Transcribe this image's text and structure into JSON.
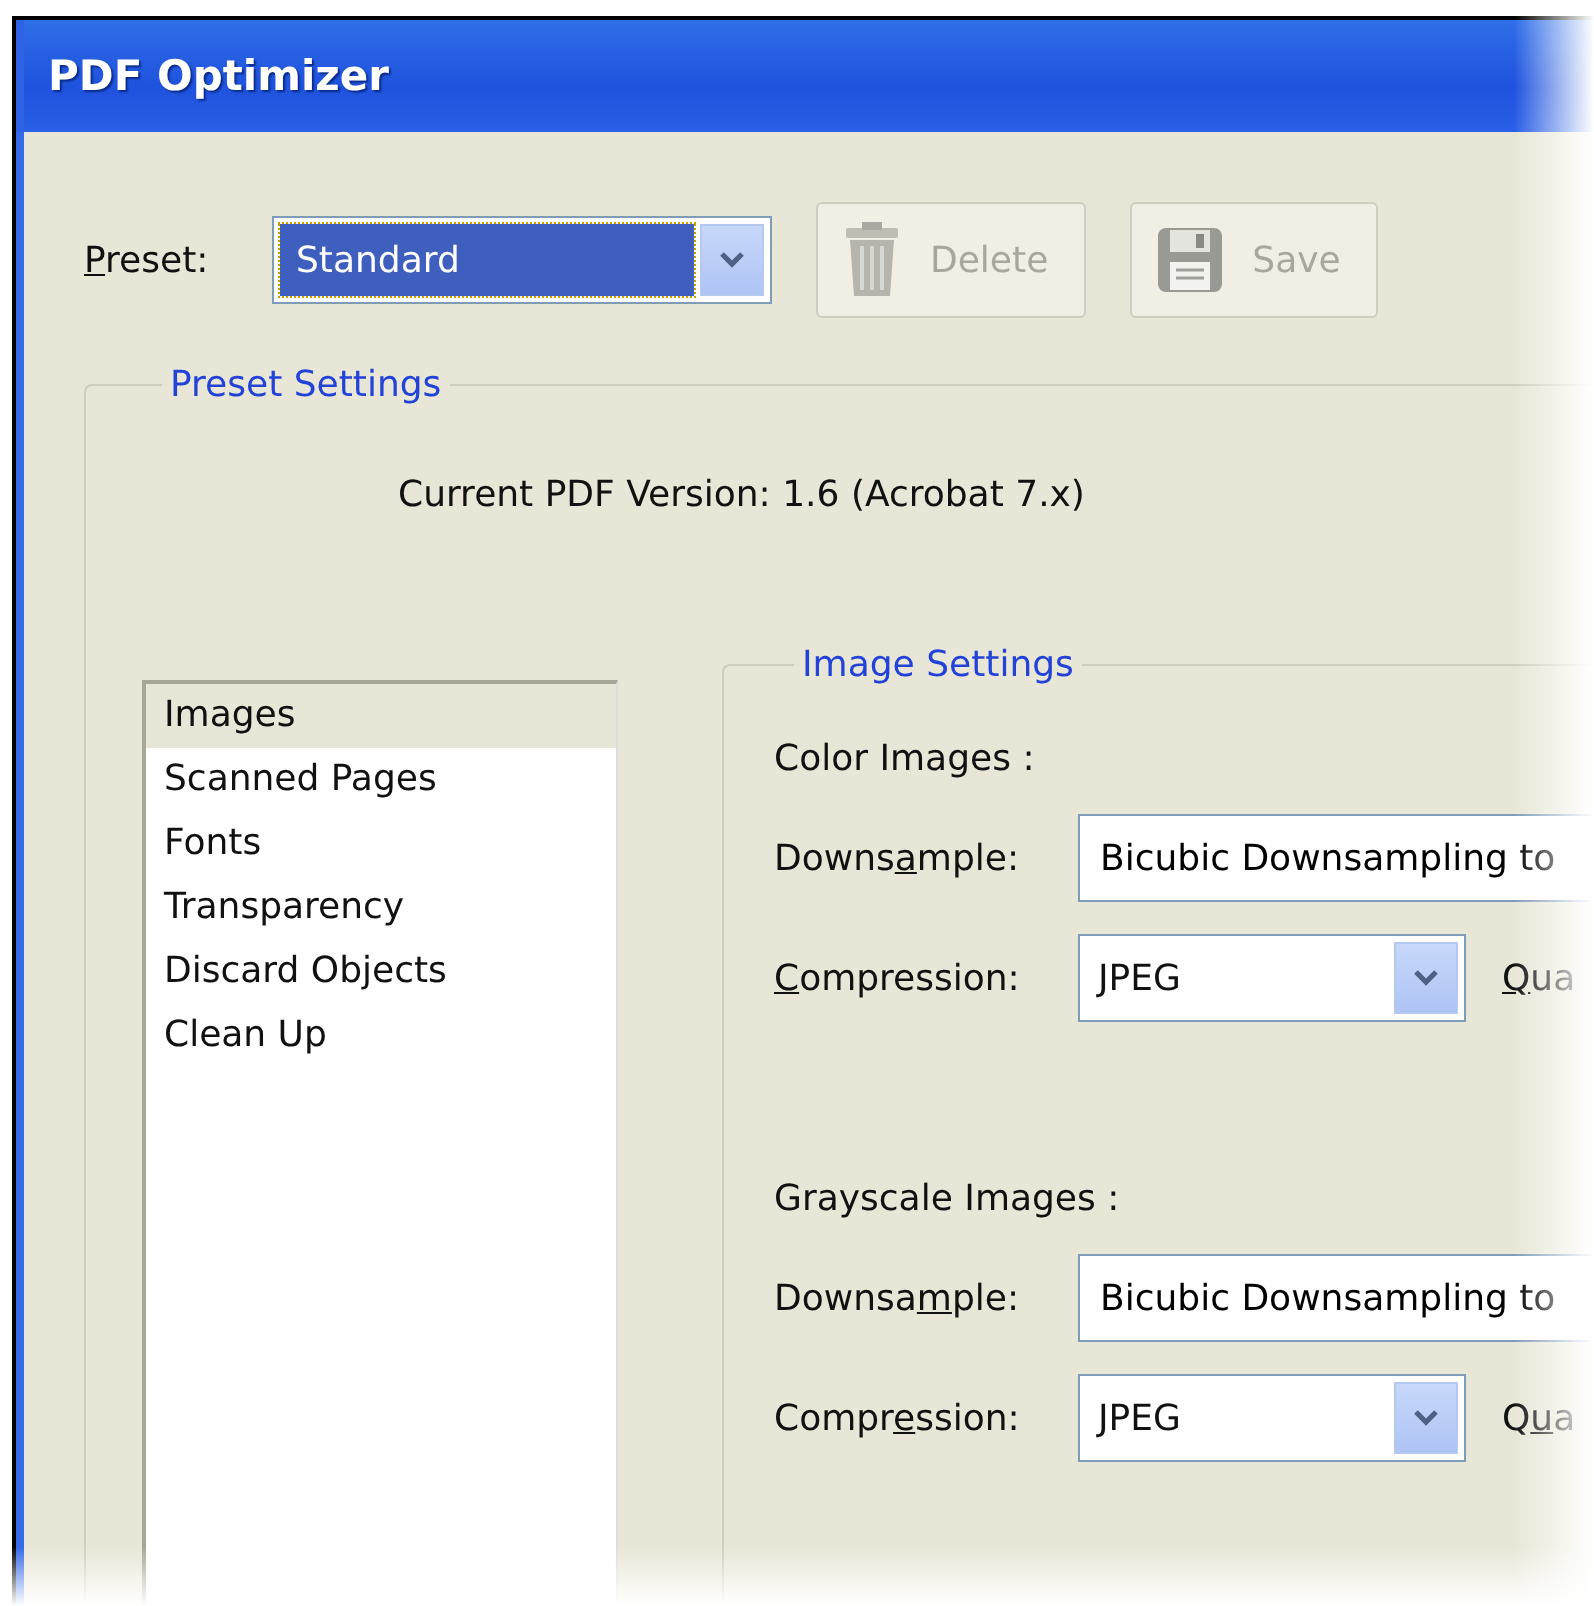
{
  "window": {
    "title": "PDF Optimizer"
  },
  "preset": {
    "label": [
      {
        "text": "P",
        "underlined": true
      },
      {
        "text": "reset:",
        "underlined": false
      }
    ],
    "value": "Standard",
    "focused": true
  },
  "buttons": [
    {
      "kind": "delete",
      "label": "Delete",
      "disabled": true
    },
    {
      "kind": "save",
      "label": "Save",
      "disabled": true
    }
  ],
  "preset_settings": {
    "title": "Preset Settings",
    "version": "Current PDF Version: 1.6 (Acrobat 7.x)",
    "categories": [
      {
        "label": "Images",
        "selected": true
      },
      {
        "label": "Scanned Pages",
        "selected": false
      },
      {
        "label": "Fonts",
        "selected": false
      },
      {
        "label": "Transparency",
        "selected": false
      },
      {
        "label": "Discard Objects",
        "selected": false
      },
      {
        "label": "Clean Up",
        "selected": false
      }
    ],
    "image_settings": {
      "title": "Image Settings",
      "sections": [
        {
          "heading": "Color Images :",
          "downsample": {
            "label": [
              {
                "text": "Downs",
                "underlined": false
              },
              {
                "text": "a",
                "underlined": true
              },
              {
                "text": "mple:",
                "underlined": false
              }
            ],
            "value": "Bicubic Downsampling to"
          },
          "compression": {
            "label": [
              {
                "text": "C",
                "underlined": true
              },
              {
                "text": "ompression:",
                "underlined": false
              }
            ],
            "value": "JPEG"
          },
          "quality": {
            "label": [
              {
                "text": "Q",
                "underlined": true
              },
              {
                "text": "ua",
                "underlined": false
              }
            ]
          }
        },
        {
          "heading": "Grayscale Images :",
          "downsample": {
            "label": [
              {
                "text": "Downsa",
                "underlined": false
              },
              {
                "text": "m",
                "underlined": true
              },
              {
                "text": "ple:",
                "underlined": false
              }
            ],
            "value": "Bicubic Downsampling to"
          },
          "compression": {
            "label": [
              {
                "text": "Compr",
                "underlined": false
              },
              {
                "text": "e",
                "underlined": true
              },
              {
                "text": "ssion:",
                "underlined": false
              }
            ],
            "value": "JPEG"
          },
          "quality": {
            "label": [
              {
                "text": "Q",
                "underlined": false
              },
              {
                "text": "u",
                "underlined": true
              },
              {
                "text": "a",
                "underlined": false
              }
            ]
          }
        }
      ]
    }
  }
}
